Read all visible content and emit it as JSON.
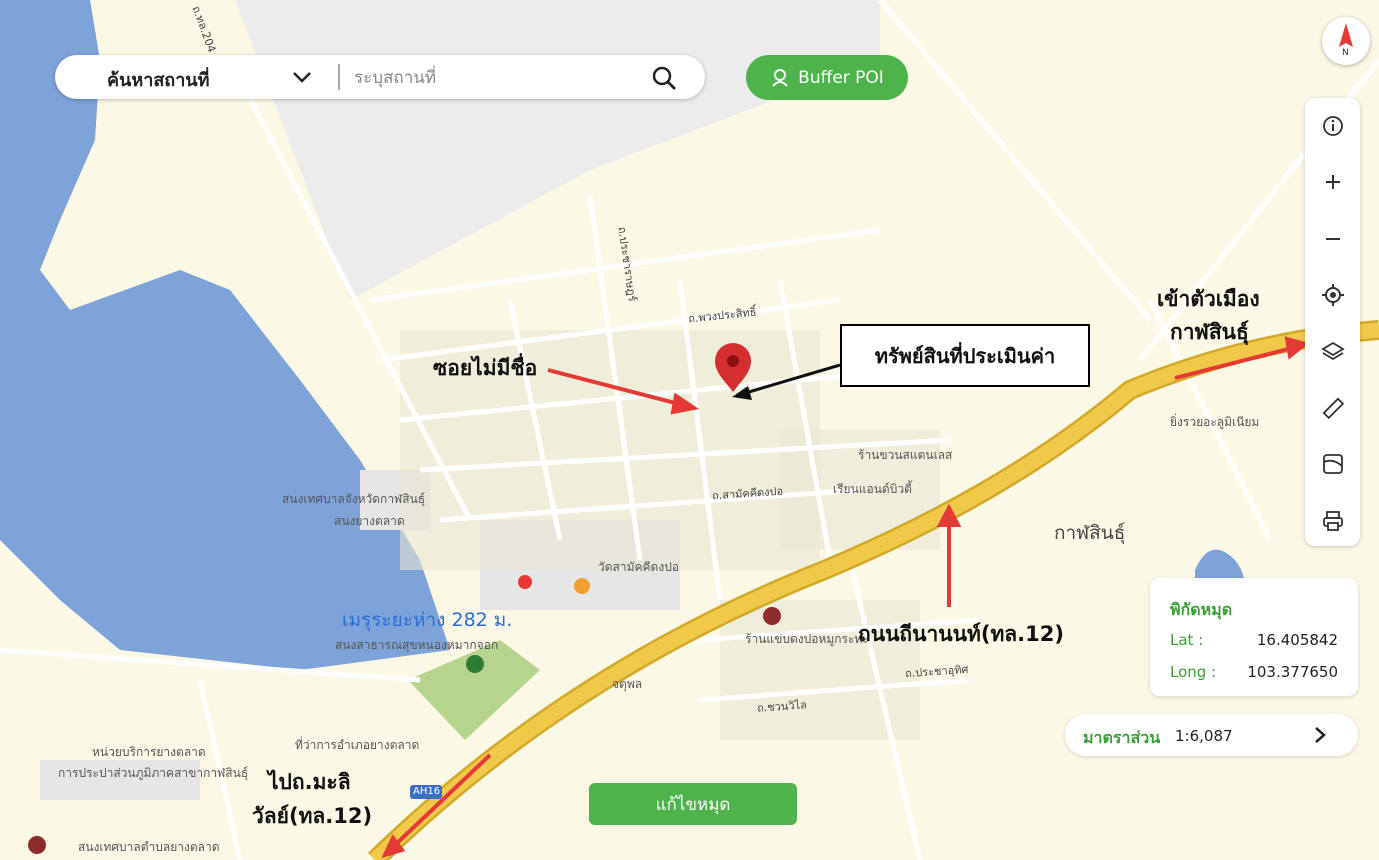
{
  "search": {
    "type_label": "ค้นหาสถานที่",
    "placeholder": "ระบุสถานที่",
    "buffer_label": "Buffer POI",
    "chevron_icon": "chevron-down-icon",
    "search_icon": "search-icon",
    "buffer_icon": "user-pin-icon"
  },
  "toolbar": {
    "compass_letter": "N",
    "tools": [
      "info-icon",
      "zoom-in-icon",
      "zoom-out-icon",
      "locate-icon",
      "layers-icon",
      "ruler-icon",
      "map-style-icon",
      "print-icon"
    ]
  },
  "coords": {
    "title": "พิกัดหมุด",
    "lat_label": "Lat :",
    "lat_value": "16.405842",
    "long_label": "Long :",
    "long_value": "103.377650"
  },
  "scale": {
    "label": "มาตราส่วน",
    "value": "1:6,087"
  },
  "edit_button": "แก้ไขหมุด",
  "annotations": {
    "asset": "ทรัพย์สินที่ประเมินค่า",
    "unnamed_soi": "ซอยไม่มีชื่อ",
    "to_city_line1": "เข้าตัวเมือง",
    "to_city_line2": "กาฬสินธุ์",
    "thanon": "ถนนถีนานนท์(ทล.12)",
    "to_line1": "ไปถ.มะลิ",
    "to_line2": "วัลย์(ทล.12)"
  },
  "map_labels": {
    "distance": "เมรุระยะห่าง 282 ม.",
    "kalasin": "กาฬสินธุ์",
    "temple": "วัดสามัคคีดงปอ",
    "road_pradit": "ถ.พวงประสิทธิ์",
    "road_prachard": "ถ.ประชาราษฎร์",
    "road_samakkhi": "ถ.สามัคคีดงปอ",
    "road_prachauthit": "ถ.ประชาอุทิศ",
    "road_chuanwilai": "ถ.ชวนวิไล",
    "shop1": "ร้านขวนสแตนเลส",
    "shop2": "เรียนแอนด์บิวตี้",
    "shop3": "ยิ่งรวยอะลูมิเนียม",
    "shop4": "ร้านแข่บดงปอหมูกระทะ",
    "shop5": "จตุพล",
    "school1": "สนงเทศบาลจังหวัดกาฬสินธุ์",
    "school1b": "สนงยางตลาด",
    "hospital": "สนงสาธารณสุขหนองหมากจอก",
    "office1": "หน่วยบริการยางตลาด",
    "office2": "การประปาส่วนภูมิภาคสาขากาฬสินธุ์",
    "office3": "ที่ว่าการอำเภอยางตลาด",
    "office4": "สนงเทศบาลตำบลยางตลาด",
    "highway": "AH16",
    "tl_road": "ถ.ทล.204"
  },
  "colors": {
    "water": "#7ea3d8",
    "land": "#fbf8e6",
    "highway": "#f0c94a",
    "green": "#4db34a",
    "arrow_red": "#e53935",
    "pin": "#d32f2f"
  }
}
